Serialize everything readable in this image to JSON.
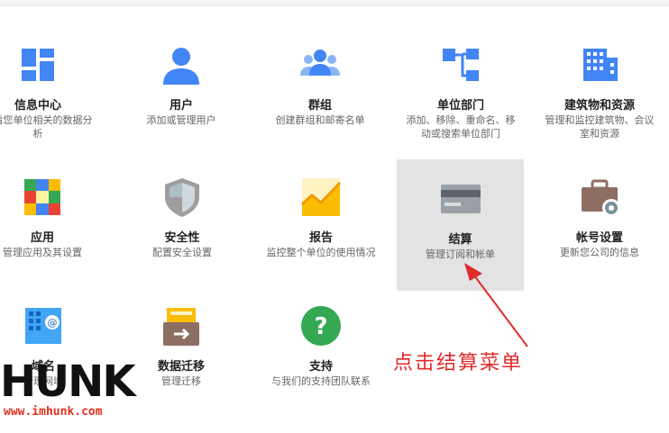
{
  "tiles": [
    {
      "title": "信息中心",
      "desc": "查看您单位相关的数据分析",
      "icon": "dashboard-icon"
    },
    {
      "title": "用户",
      "desc": "添加或管理用户",
      "icon": "user-icon"
    },
    {
      "title": "群组",
      "desc": "创建群组和邮寄名单",
      "icon": "groups-icon"
    },
    {
      "title": "单位部门",
      "desc": "添加、移除、重命名、移动或搜索单位部门",
      "icon": "org-units-icon"
    },
    {
      "title": "建筑物和资源",
      "desc": "管理和监控建筑物、会议室和资源",
      "icon": "building-icon"
    },
    {
      "title": "应用",
      "desc": "管理应用及其设置",
      "icon": "apps-icon"
    },
    {
      "title": "安全性",
      "desc": "配置安全设置",
      "icon": "shield-icon"
    },
    {
      "title": "报告",
      "desc": "监控整个单位的使用情况",
      "icon": "reports-chart-icon"
    },
    {
      "title": "结算",
      "desc": "管理订阅和帐单",
      "icon": "credit-card-icon"
    },
    {
      "title": "帐号设置",
      "desc": "更新您公司的信息",
      "icon": "briefcase-gear-icon"
    },
    {
      "title": "域名",
      "desc": "管理网域",
      "icon": "domains-icon"
    },
    {
      "title": "数据迁移",
      "desc": "管理迁移",
      "icon": "data-migration-icon"
    },
    {
      "title": "支持",
      "desc": "与我们的支持团队联系",
      "icon": "help-icon"
    }
  ],
  "selected_tile": "结算",
  "annotation": "点击结算菜单",
  "watermark": {
    "logo": "HUNK",
    "url": "www.imhunk.com"
  },
  "colors": {
    "blue": "#4285f4",
    "green": "#34a853",
    "yellow": "#fbbc05",
    "red": "#ea4335",
    "note": "#e02b2b"
  }
}
